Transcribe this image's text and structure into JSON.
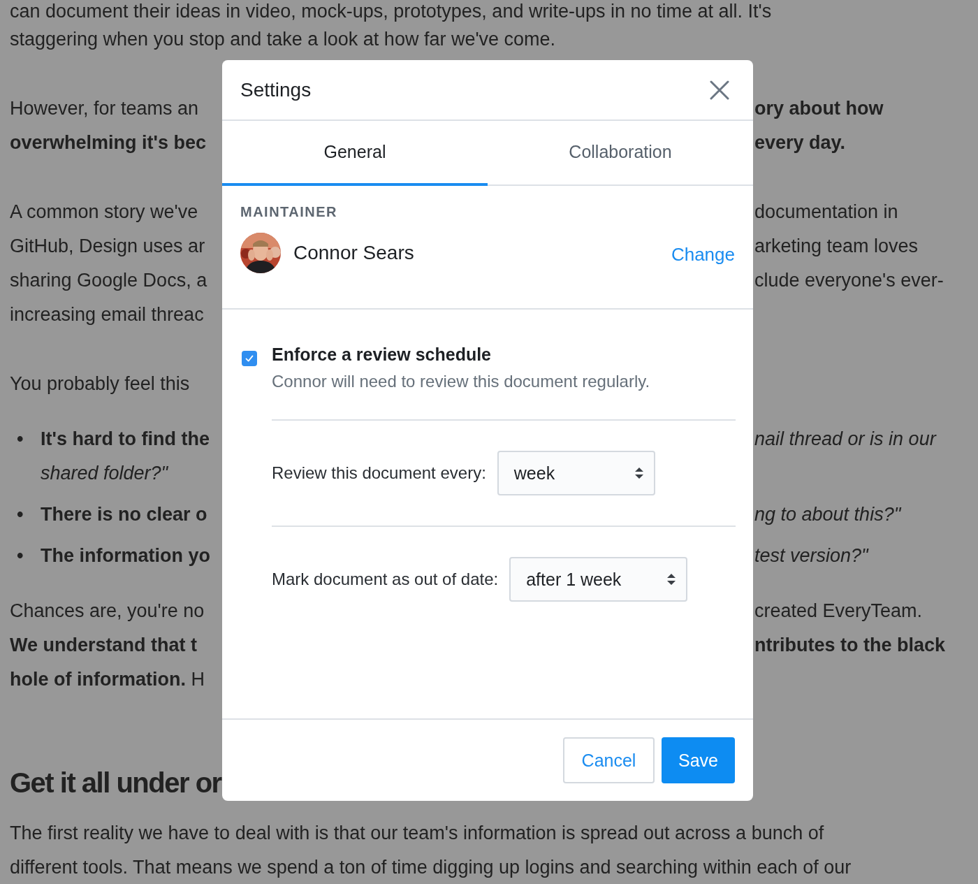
{
  "article": {
    "blocks": [
      {
        "kind": "paragraph",
        "lines": [
          {
            "kind": "full",
            "text": "can document their ideas in video, mock-ups, prototypes, and write-ups in no time at all. It's"
          },
          {
            "kind": "full",
            "text": "staggering when you stop and take a look at how far we've come."
          }
        ]
      },
      {
        "kind": "paragraph",
        "lines": [
          {
            "kind": "split",
            "left": {
              "text": "However, for teams an",
              "kind": "plain"
            },
            "right": {
              "text": "ory about how",
              "kind": "strong"
            }
          },
          {
            "kind": "split",
            "left": {
              "text": "overwhelming it's bec",
              "kind": "strong"
            },
            "right": {
              "text": "every day.",
              "kind": "strong"
            }
          }
        ]
      },
      {
        "kind": "paragraph",
        "lines": [
          {
            "kind": "split",
            "left": {
              "text": "A common story we've",
              "kind": "plain"
            },
            "right": {
              "text": "documentation in",
              "kind": "plain"
            }
          },
          {
            "kind": "split",
            "left": {
              "text": "GitHub, Design uses ar",
              "kind": "plain"
            },
            "right": {
              "text": "arketing team loves",
              "kind": "plain"
            }
          },
          {
            "kind": "split",
            "left": {
              "text": "sharing Google Docs, a",
              "kind": "plain"
            },
            "right": {
              "text": "clude everyone's ever-",
              "kind": "plain"
            }
          },
          {
            "kind": "split",
            "left": {
              "text": "increasing email threac",
              "kind": "plain"
            }
          }
        ]
      },
      {
        "kind": "paragraph",
        "lines": [
          {
            "kind": "split",
            "left": {
              "text": "You probably feel this",
              "kind": "plain"
            }
          }
        ]
      },
      {
        "kind": "list",
        "items": [
          {
            "bullet": "•",
            "lines": [
              {
                "left": {
                  "text": "It's hard to find the",
                  "kind": "strong"
                },
                "right": {
                  "text": "nail thread or is in our",
                  "kind": "quote"
                }
              },
              {
                "left": {
                  "text": "shared folder?\"",
                  "kind": "quote"
                }
              }
            ]
          },
          {
            "bullet": "•",
            "lines": [
              {
                "left": {
                  "text": "There is no clear o",
                  "kind": "strong"
                },
                "right": {
                  "text": "ng to about this?\"",
                  "kind": "quote"
                }
              }
            ]
          },
          {
            "bullet": "•",
            "lines": [
              {
                "left": {
                  "text": "The information yo",
                  "kind": "strong"
                },
                "right": {
                  "text": "test version?\"",
                  "kind": "quote"
                }
              }
            ]
          }
        ]
      },
      {
        "kind": "paragraph",
        "lines": [
          {
            "kind": "split",
            "left": {
              "text": "Chances are, you're no",
              "kind": "plain"
            },
            "right": {
              "text": "created EveryTeam.",
              "kind": "plain"
            }
          },
          {
            "kind": "split",
            "left": {
              "text": "We understand that t",
              "kind": "strong"
            },
            "right": {
              "text": "ntributes to the black",
              "kind": "strong"
            }
          },
          {
            "kind": "split",
            "left": {
              "text": "**hole of information.** H",
              "kind": "plain"
            }
          }
        ]
      },
      {
        "kind": "heading",
        "lines": [
          {
            "kind": "split",
            "left": {
              "text": "Get it all under or",
              "kind": "plain"
            }
          }
        ]
      },
      {
        "kind": "paragraph",
        "lines": [
          {
            "kind": "full",
            "text": "The first reality we have to deal with is that our team's information is spread out across a bunch of"
          },
          {
            "kind": "full",
            "text": "different tools. That means we spend a ton of time digging up logins and searching within each of our"
          }
        ]
      }
    ]
  },
  "dialog": {
    "title": "Settings",
    "tabs": [
      {
        "label": "General",
        "selected": true
      },
      {
        "label": "Collaboration",
        "selected": false
      }
    ],
    "maintainer": {
      "label": "MAINTAINER",
      "name": "Connor Sears",
      "action": "Change"
    },
    "review": {
      "checked": true,
      "title": "Enforce a review schedule",
      "description": "Connor will need to review this document regularly."
    },
    "selects": [
      {
        "label": "Review this document every:",
        "value": "week"
      },
      {
        "label": "Mark document as out of date:",
        "value": "after 1 week"
      }
    ],
    "buttons": [
      {
        "label": "Cancel",
        "kind": "secondary"
      },
      {
        "label": "Save",
        "kind": "primary"
      }
    ]
  }
}
